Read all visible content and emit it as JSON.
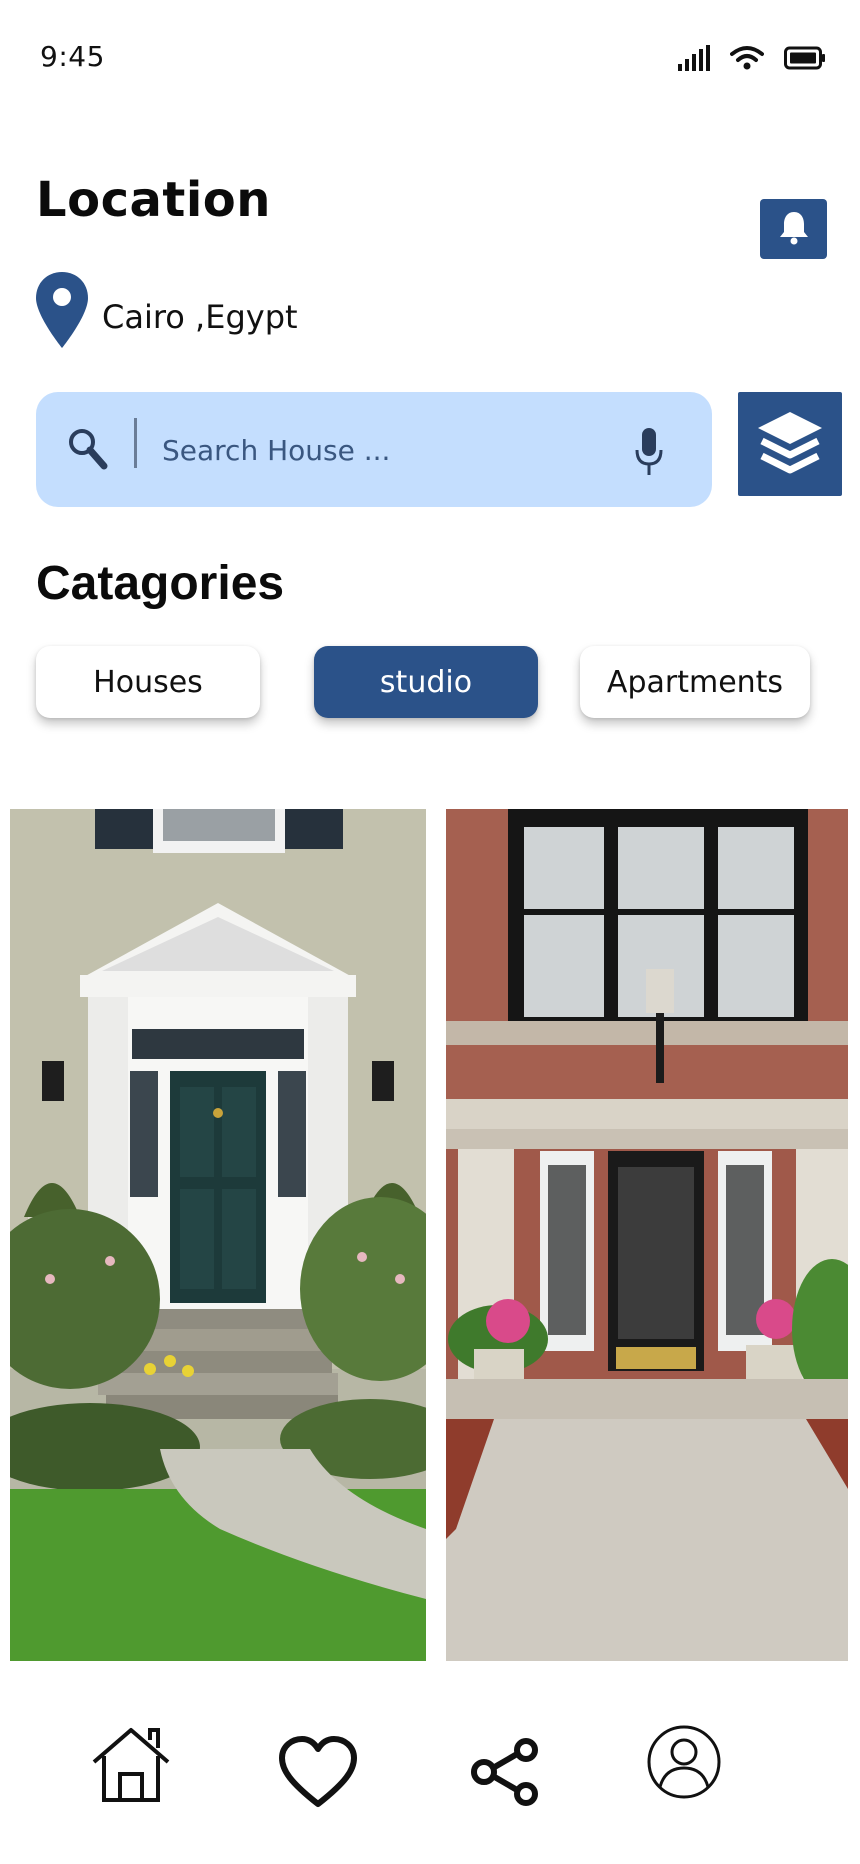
{
  "status_bar": {
    "time": "9:45",
    "icons": [
      "cellular-signal-icon",
      "wifi-icon",
      "battery-icon"
    ]
  },
  "location": {
    "heading": "Location",
    "city": "Cairo ,Egypt",
    "pin_icon": "map-pin-icon",
    "notification_icon": "bell-icon"
  },
  "search": {
    "placeholder": "Search House ...",
    "search_icon": "magnifier-icon",
    "mic_icon": "microphone-icon",
    "filter_icon": "layers-icon"
  },
  "categories": {
    "heading": "Catagories",
    "items": [
      {
        "label": "Houses",
        "active": false
      },
      {
        "label": "studio",
        "active": true
      },
      {
        "label": "Apartments",
        "active": false
      }
    ]
  },
  "listings": [
    {
      "image": "white-portico-house-entrance-photo"
    },
    {
      "image": "brick-building-glass-entrance-photo"
    }
  ],
  "bottom_nav": {
    "items": [
      {
        "icon": "home-icon"
      },
      {
        "icon": "heart-icon"
      },
      {
        "icon": "share-icon"
      },
      {
        "icon": "user-profile-icon"
      }
    ]
  },
  "colors": {
    "primary": "#2b5289",
    "search_background": "#c4defe",
    "background": "#ffffff",
    "text": "#111111"
  }
}
